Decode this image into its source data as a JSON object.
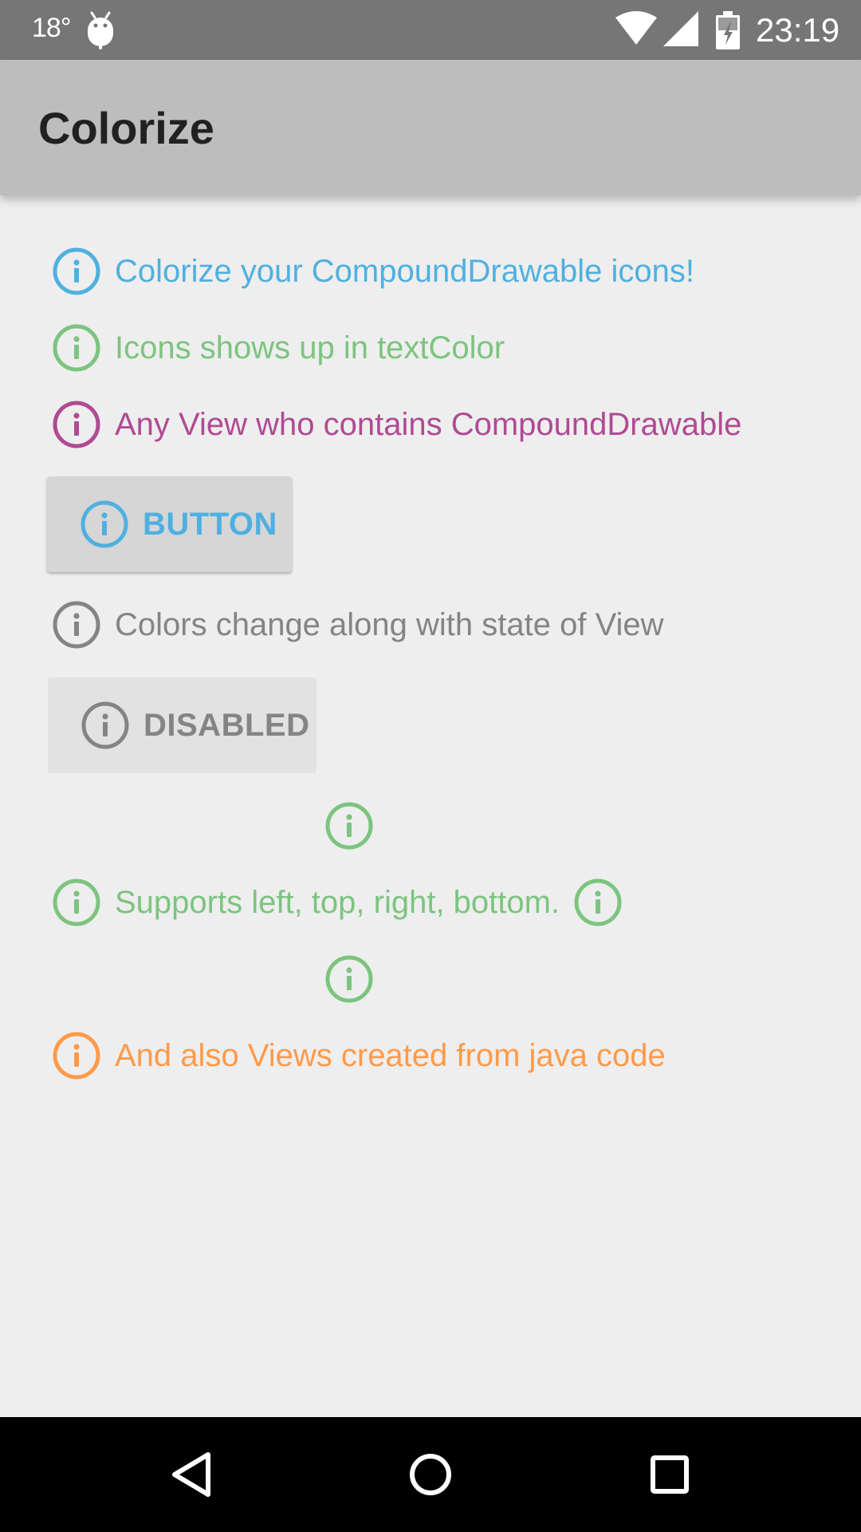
{
  "status_bar": {
    "temperature": "18°",
    "time": "23:19",
    "icons": [
      "android-icon",
      "wifi-icon",
      "signal-icon",
      "battery-icon"
    ]
  },
  "app_bar": {
    "title": "Colorize"
  },
  "colors": {
    "blue": "#4fb0e0",
    "green": "#7cc47f",
    "purple": "#b04a93",
    "gray": "#848484",
    "orange": "#ff9a4a"
  },
  "content": {
    "row1": {
      "text": "Colorize your CompoundDrawable icons!",
      "color": "#4fb0e0",
      "icon": "info-icon"
    },
    "row2": {
      "text": "Icons shows up in textColor",
      "color": "#7cc47f",
      "icon": "info-icon"
    },
    "row3": {
      "text": "Any View who contains CompoundDrawable",
      "color": "#b04a93",
      "icon": "info-icon"
    },
    "button": {
      "label": "BUTTON",
      "color": "#4fb0e0",
      "icon": "info-icon"
    },
    "row4": {
      "text": "Colors change along with state of View",
      "color": "#848484",
      "icon": "info-icon"
    },
    "disabled_button": {
      "label": "DISABLED",
      "color": "#848484",
      "icon": "info-icon"
    },
    "supports": {
      "text": "Supports left, top, right, bottom.",
      "color": "#7cc47f",
      "icon": "info-icon"
    },
    "row5": {
      "text": "And also Views created from java code",
      "color": "#ff9a4a",
      "icon": "info-icon"
    }
  },
  "nav_bar": {
    "icons": [
      "back-icon",
      "home-icon",
      "recents-icon"
    ]
  }
}
